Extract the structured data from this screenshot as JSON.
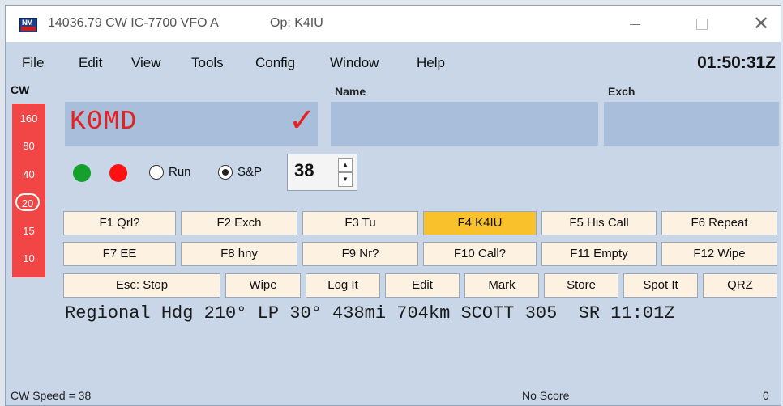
{
  "titlebar": {
    "title": "14036.79 CW IC-7700 VFO A",
    "operator": "Op: K4IU",
    "close_glyph": "✕"
  },
  "menu": {
    "items": [
      "File",
      "Edit",
      "View",
      "Tools",
      "Config",
      "Window",
      "Help"
    ],
    "clock": "01:50:31Z"
  },
  "mode": "CW",
  "bands": [
    "160",
    "80",
    "40",
    "20",
    "15",
    "10"
  ],
  "selected_band": "20",
  "fields": {
    "name_label": "Name",
    "exch_label": "Exch",
    "callsign": "K0MD",
    "name": "",
    "exch": "",
    "check": "✓"
  },
  "controls": {
    "run_label": "Run",
    "sp_label": "S&P",
    "mode_selected": "S&P",
    "speed": "38"
  },
  "fkeys_row1": [
    "F1 Qrl?",
    "F2 Exch",
    "F3 Tu",
    "F4 K4IU",
    "F5 His Call",
    "F6 Repeat"
  ],
  "fkeys_row2": [
    "F7 EE",
    "F8 hny",
    "F9 Nr?",
    "F10 Call?",
    "F11 Empty",
    "F12 Wipe"
  ],
  "fkeys_row3": [
    "Esc: Stop",
    "Wipe",
    "Log It",
    "Edit",
    "Mark",
    "Store",
    "Spot It",
    "QRZ"
  ],
  "active_key": "F4 K4IU",
  "info_line": "Regional Hdg 210° LP 30° 438mi 704km SCOTT 305  SR 11:01Z",
  "status": {
    "cw_speed": "CW Speed = 38",
    "score": "No Score",
    "count": "0"
  },
  "colors": {
    "accent_red": "#e52222",
    "band_panel": "#f24545",
    "active_key": "#f9c22d",
    "field_bg": "#a9bedb"
  }
}
